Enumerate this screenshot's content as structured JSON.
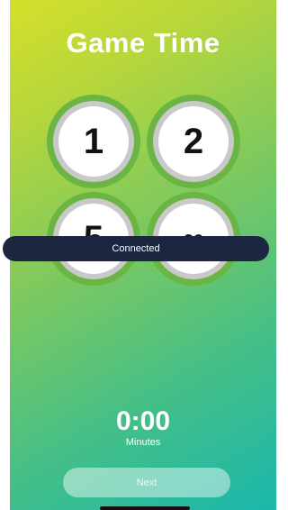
{
  "screen": {
    "title": "Game Time"
  },
  "options": [
    {
      "label": "1"
    },
    {
      "label": "2"
    },
    {
      "label": "5"
    },
    {
      "label": "∞"
    }
  ],
  "toast": {
    "text": "Connected"
  },
  "timer": {
    "value": "0:00",
    "unit": "Minutes"
  },
  "next_button": {
    "label": "Next",
    "state": "disabled"
  }
}
